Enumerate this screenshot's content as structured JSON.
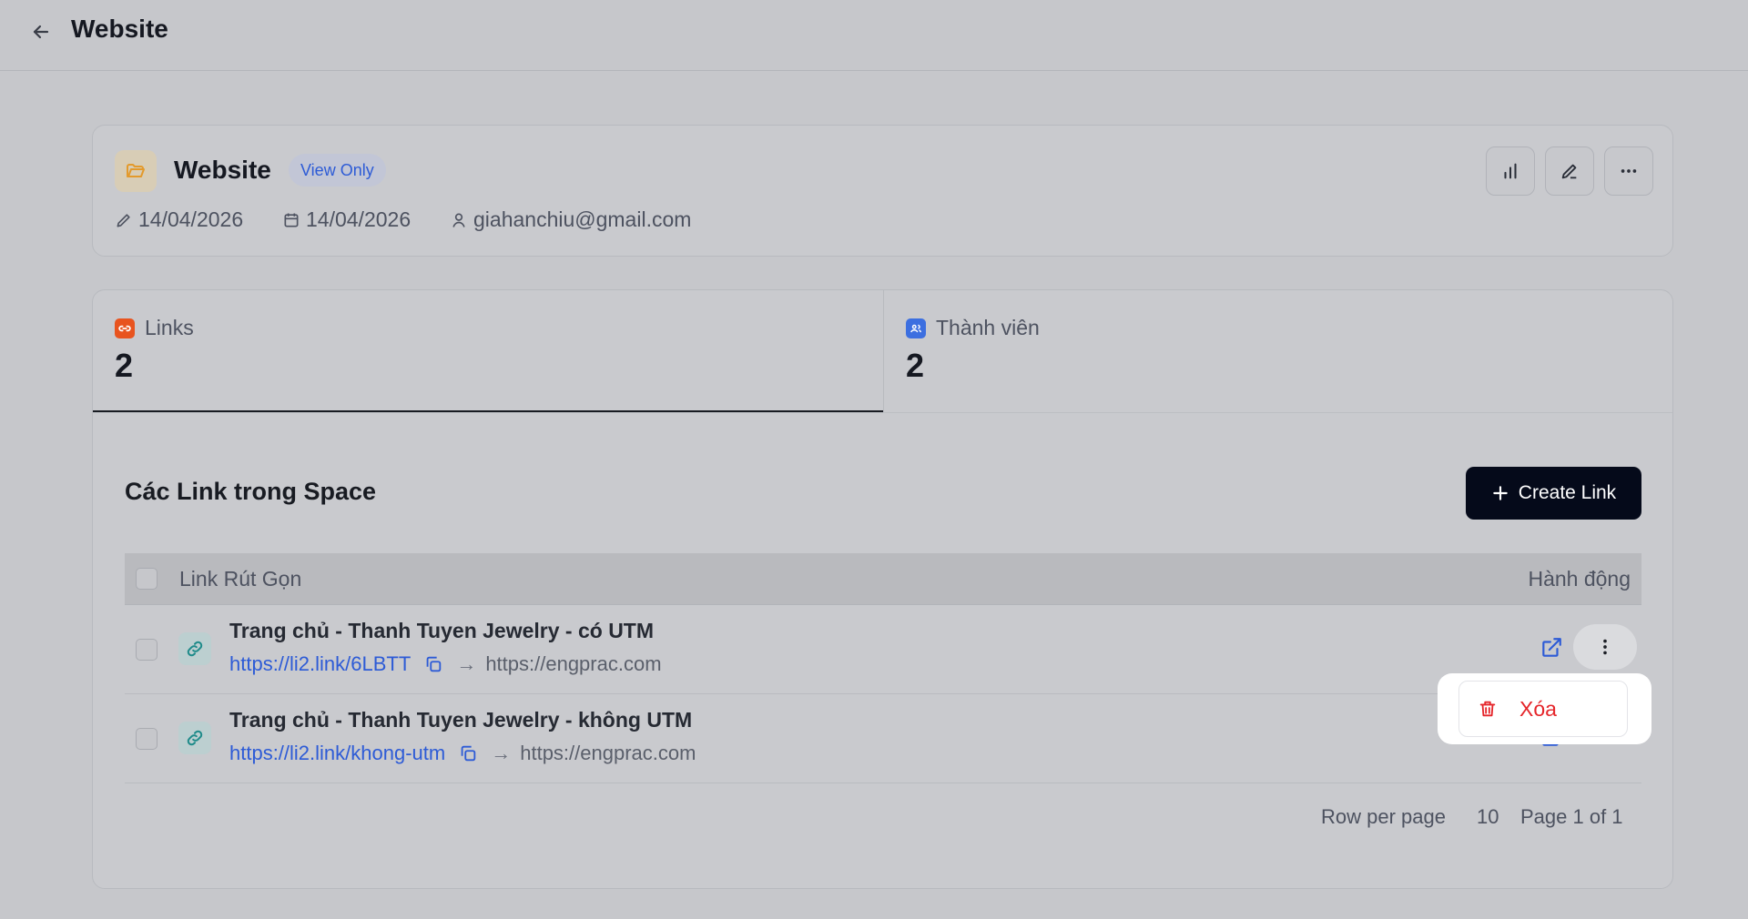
{
  "header": {
    "title": "Website",
    "back_icon": "arrow-left-icon"
  },
  "space": {
    "name": "Website",
    "badge": "View Only",
    "edited_date": "14/04/2026",
    "created_date": "14/04/2026",
    "owner_email": "giahanchiu@gmail.com"
  },
  "tabs": [
    {
      "label": "Links",
      "count": "2",
      "icon": "link-icon",
      "color": "#e8541f",
      "active": true
    },
    {
      "label": "Thành viên",
      "count": "2",
      "icon": "users-icon",
      "color": "#3c6fe0",
      "active": false
    }
  ],
  "links_section": {
    "title": "Các Link trong Space",
    "create_label": "Create Link",
    "col_link": "Link Rút Gọn",
    "col_action": "Hành động",
    "rows": [
      {
        "title": "Trang chủ - Thanh Tuyen Jewelry - có UTM",
        "short_url": "https://li2.link/6LBTT",
        "arrow": "→",
        "dest": "https://engprac.com"
      },
      {
        "title": "Trang chủ - Thanh Tuyen Jewelry - không UTM",
        "short_url": "https://li2.link/khong-utm",
        "arrow": "→",
        "dest": "https://engprac.com"
      }
    ],
    "pagination": {
      "rows_label": "Row per page",
      "rows_value": "10",
      "page_label": "Page 1 of 1"
    }
  },
  "context_menu": {
    "delete_label": "Xóa"
  },
  "colors": {
    "accent": "#2d5bd6",
    "primary_button": "#050a1a",
    "danger": "#e5252a"
  }
}
